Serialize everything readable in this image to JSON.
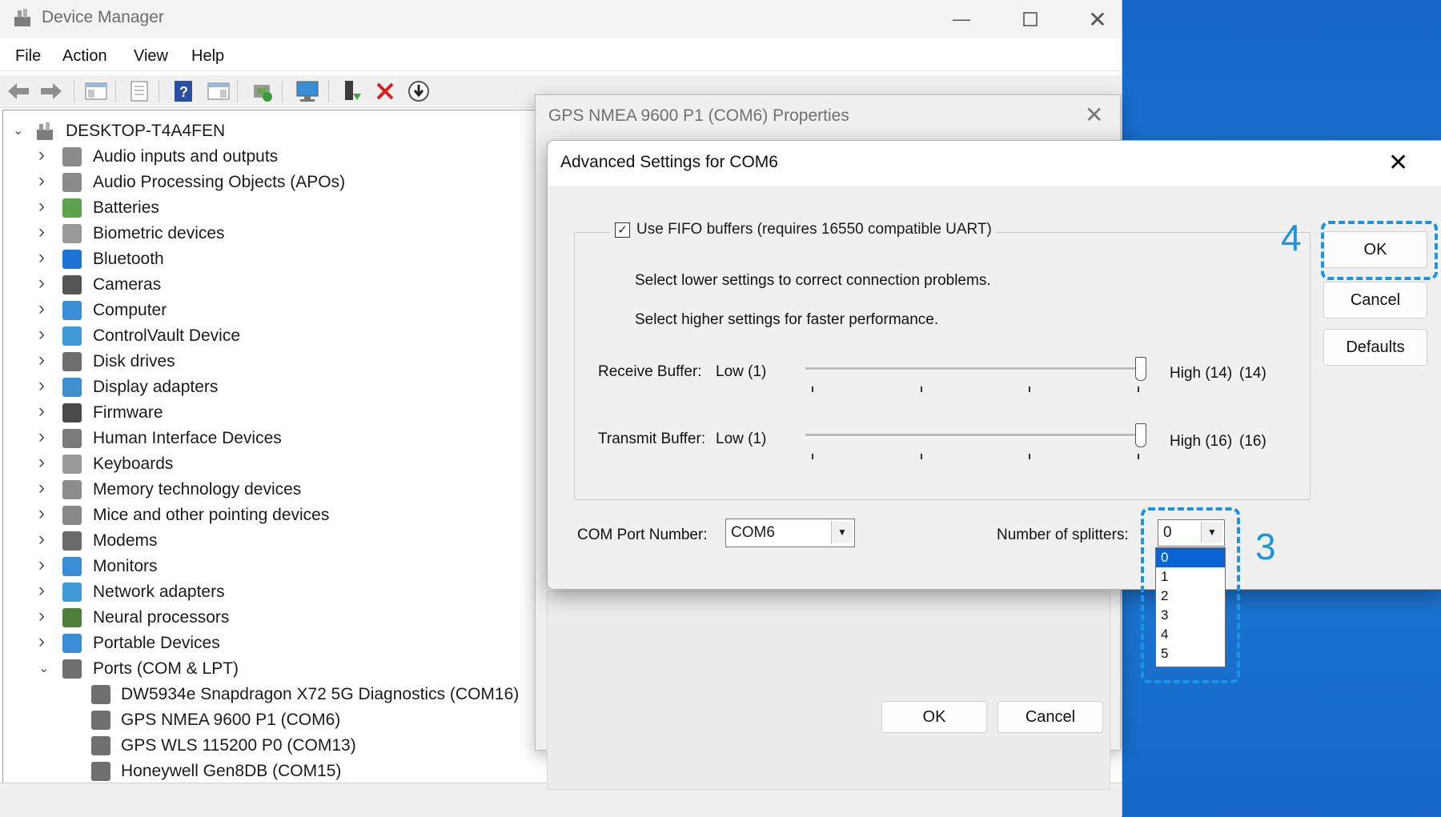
{
  "device_manager": {
    "title": "Device Manager",
    "menu": [
      "File",
      "Action",
      "View",
      "Help"
    ],
    "root": "DESKTOP-T4A4FEN",
    "categories": [
      {
        "label": "Audio inputs and outputs",
        "icon": "speaker-icon"
      },
      {
        "label": "Audio Processing Objects (APOs)",
        "icon": "speaker-icon"
      },
      {
        "label": "Batteries",
        "icon": "battery-icon"
      },
      {
        "label": "Biometric devices",
        "icon": "fingerprint-icon"
      },
      {
        "label": "Bluetooth",
        "icon": "bluetooth-icon"
      },
      {
        "label": "Cameras",
        "icon": "camera-icon"
      },
      {
        "label": "Computer",
        "icon": "monitor-icon"
      },
      {
        "label": "ControlVault Device",
        "icon": "network-monitor-icon"
      },
      {
        "label": "Disk drives",
        "icon": "disk-icon"
      },
      {
        "label": "Display adapters",
        "icon": "display-adapter-icon"
      },
      {
        "label": "Firmware",
        "icon": "firmware-icon"
      },
      {
        "label": "Human Interface Devices",
        "icon": "hid-icon"
      },
      {
        "label": "Keyboards",
        "icon": "keyboard-icon"
      },
      {
        "label": "Memory technology devices",
        "icon": "memory-icon"
      },
      {
        "label": "Mice and other pointing devices",
        "icon": "mouse-icon"
      },
      {
        "label": "Modems",
        "icon": "modem-icon"
      },
      {
        "label": "Monitors",
        "icon": "monitor-icon"
      },
      {
        "label": "Network adapters",
        "icon": "network-monitor-icon"
      },
      {
        "label": "Neural processors",
        "icon": "chip-icon"
      },
      {
        "label": "Portable Devices",
        "icon": "portable-device-icon"
      },
      {
        "label": "Ports (COM & LPT)",
        "icon": "port-icon"
      }
    ],
    "ports": [
      "DW5934e Snapdragon X72 5G Diagnostics (COM16)",
      "GPS NMEA 9600 P1 (COM6)",
      "GPS WLS 115200 P0 (COM13)",
      "Honeywell Gen8DB (COM15)"
    ]
  },
  "properties_dialog": {
    "title": "GPS NMEA 9600 P1 (COM6) Properties",
    "ok_label": "OK",
    "cancel_label": "Cancel"
  },
  "advanced_dialog": {
    "title": "Advanced Settings for COM6",
    "fifo_label": "Use FIFO buffers (requires 16550 compatible UART)",
    "fifo_checked": true,
    "hint_lower": "Select lower settings to correct connection problems.",
    "hint_higher": "Select higher settings for faster performance.",
    "receive": {
      "label": "Receive Buffer:",
      "low": "Low (1)",
      "high": "High (14)",
      "value": "(14)",
      "level": 14,
      "max": 14
    },
    "transmit": {
      "label": "Transmit Buffer:",
      "low": "Low (1)",
      "high": "High (16)",
      "value": "(16)",
      "level": 16,
      "max": 16
    },
    "com_port_label": "COM Port Number:",
    "com_port_value": "COM6",
    "splitters_label": "Number of splitters:",
    "splitters_value": "0",
    "splitters_options": [
      "0",
      "1",
      "2",
      "3",
      "4",
      "5"
    ],
    "splitters_selected": "0",
    "ok_label": "OK",
    "cancel_label": "Cancel",
    "defaults_label": "Defaults"
  },
  "callouts": {
    "ok_step": "4",
    "splitters_step": "3"
  },
  "colors": {
    "accent": "#1b95e0",
    "selection": "#0a63d4",
    "desktop": "#1a6fc9"
  }
}
